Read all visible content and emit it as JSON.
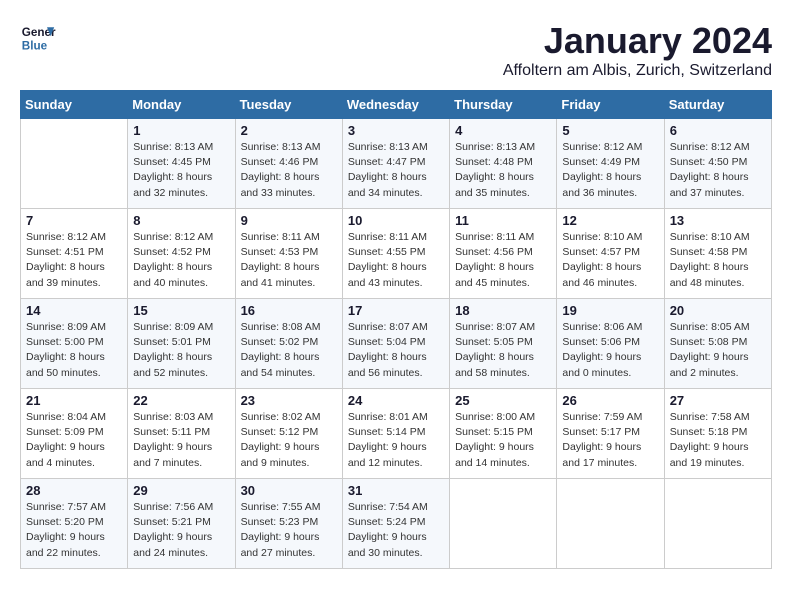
{
  "header": {
    "logo_line1": "General",
    "logo_line2": "Blue",
    "title": "January 2024",
    "subtitle": "Affoltern am Albis, Zurich, Switzerland"
  },
  "days_of_week": [
    "Sunday",
    "Monday",
    "Tuesday",
    "Wednesday",
    "Thursday",
    "Friday",
    "Saturday"
  ],
  "weeks": [
    [
      {
        "day": "",
        "info": ""
      },
      {
        "day": "1",
        "info": "Sunrise: 8:13 AM\nSunset: 4:45 PM\nDaylight: 8 hours\nand 32 minutes."
      },
      {
        "day": "2",
        "info": "Sunrise: 8:13 AM\nSunset: 4:46 PM\nDaylight: 8 hours\nand 33 minutes."
      },
      {
        "day": "3",
        "info": "Sunrise: 8:13 AM\nSunset: 4:47 PM\nDaylight: 8 hours\nand 34 minutes."
      },
      {
        "day": "4",
        "info": "Sunrise: 8:13 AM\nSunset: 4:48 PM\nDaylight: 8 hours\nand 35 minutes."
      },
      {
        "day": "5",
        "info": "Sunrise: 8:12 AM\nSunset: 4:49 PM\nDaylight: 8 hours\nand 36 minutes."
      },
      {
        "day": "6",
        "info": "Sunrise: 8:12 AM\nSunset: 4:50 PM\nDaylight: 8 hours\nand 37 minutes."
      }
    ],
    [
      {
        "day": "7",
        "info": "Sunrise: 8:12 AM\nSunset: 4:51 PM\nDaylight: 8 hours\nand 39 minutes."
      },
      {
        "day": "8",
        "info": "Sunrise: 8:12 AM\nSunset: 4:52 PM\nDaylight: 8 hours\nand 40 minutes."
      },
      {
        "day": "9",
        "info": "Sunrise: 8:11 AM\nSunset: 4:53 PM\nDaylight: 8 hours\nand 41 minutes."
      },
      {
        "day": "10",
        "info": "Sunrise: 8:11 AM\nSunset: 4:55 PM\nDaylight: 8 hours\nand 43 minutes."
      },
      {
        "day": "11",
        "info": "Sunrise: 8:11 AM\nSunset: 4:56 PM\nDaylight: 8 hours\nand 45 minutes."
      },
      {
        "day": "12",
        "info": "Sunrise: 8:10 AM\nSunset: 4:57 PM\nDaylight: 8 hours\nand 46 minutes."
      },
      {
        "day": "13",
        "info": "Sunrise: 8:10 AM\nSunset: 4:58 PM\nDaylight: 8 hours\nand 48 minutes."
      }
    ],
    [
      {
        "day": "14",
        "info": "Sunrise: 8:09 AM\nSunset: 5:00 PM\nDaylight: 8 hours\nand 50 minutes."
      },
      {
        "day": "15",
        "info": "Sunrise: 8:09 AM\nSunset: 5:01 PM\nDaylight: 8 hours\nand 52 minutes."
      },
      {
        "day": "16",
        "info": "Sunrise: 8:08 AM\nSunset: 5:02 PM\nDaylight: 8 hours\nand 54 minutes."
      },
      {
        "day": "17",
        "info": "Sunrise: 8:07 AM\nSunset: 5:04 PM\nDaylight: 8 hours\nand 56 minutes."
      },
      {
        "day": "18",
        "info": "Sunrise: 8:07 AM\nSunset: 5:05 PM\nDaylight: 8 hours\nand 58 minutes."
      },
      {
        "day": "19",
        "info": "Sunrise: 8:06 AM\nSunset: 5:06 PM\nDaylight: 9 hours\nand 0 minutes."
      },
      {
        "day": "20",
        "info": "Sunrise: 8:05 AM\nSunset: 5:08 PM\nDaylight: 9 hours\nand 2 minutes."
      }
    ],
    [
      {
        "day": "21",
        "info": "Sunrise: 8:04 AM\nSunset: 5:09 PM\nDaylight: 9 hours\nand 4 minutes."
      },
      {
        "day": "22",
        "info": "Sunrise: 8:03 AM\nSunset: 5:11 PM\nDaylight: 9 hours\nand 7 minutes."
      },
      {
        "day": "23",
        "info": "Sunrise: 8:02 AM\nSunset: 5:12 PM\nDaylight: 9 hours\nand 9 minutes."
      },
      {
        "day": "24",
        "info": "Sunrise: 8:01 AM\nSunset: 5:14 PM\nDaylight: 9 hours\nand 12 minutes."
      },
      {
        "day": "25",
        "info": "Sunrise: 8:00 AM\nSunset: 5:15 PM\nDaylight: 9 hours\nand 14 minutes."
      },
      {
        "day": "26",
        "info": "Sunrise: 7:59 AM\nSunset: 5:17 PM\nDaylight: 9 hours\nand 17 minutes."
      },
      {
        "day": "27",
        "info": "Sunrise: 7:58 AM\nSunset: 5:18 PM\nDaylight: 9 hours\nand 19 minutes."
      }
    ],
    [
      {
        "day": "28",
        "info": "Sunrise: 7:57 AM\nSunset: 5:20 PM\nDaylight: 9 hours\nand 22 minutes."
      },
      {
        "day": "29",
        "info": "Sunrise: 7:56 AM\nSunset: 5:21 PM\nDaylight: 9 hours\nand 24 minutes."
      },
      {
        "day": "30",
        "info": "Sunrise: 7:55 AM\nSunset: 5:23 PM\nDaylight: 9 hours\nand 27 minutes."
      },
      {
        "day": "31",
        "info": "Sunrise: 7:54 AM\nSunset: 5:24 PM\nDaylight: 9 hours\nand 30 minutes."
      },
      {
        "day": "",
        "info": ""
      },
      {
        "day": "",
        "info": ""
      },
      {
        "day": "",
        "info": ""
      }
    ]
  ]
}
